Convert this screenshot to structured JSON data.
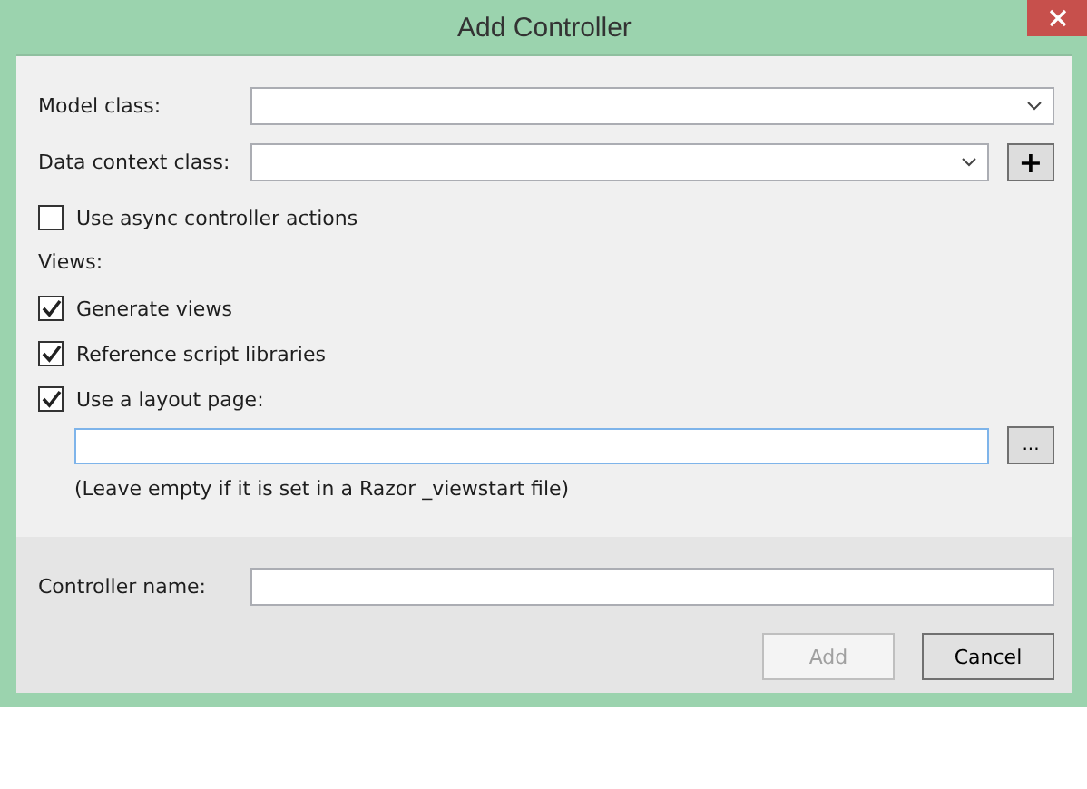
{
  "window": {
    "title": "Add Controller"
  },
  "form_rows": [
    {
      "label": "Model class:",
      "kind": "combo"
    },
    {
      "label": "Data context class:",
      "kind": "combo",
      "button": "+"
    }
  ],
  "async_option": {
    "label": "Use async controller actions",
    "checked": false
  },
  "views": {
    "label": "Views:",
    "options": [
      {
        "label": "Generate views",
        "checked": true
      },
      {
        "label": "Reference script libraries",
        "checked": true
      },
      {
        "label": "Use a layout page:",
        "checked": true
      }
    ],
    "layout_field": {
      "focused": true,
      "button": "..."
    },
    "hint": "(Leave empty if it is set in a Razor _viewstart file)"
  },
  "controller_name": {
    "label": "Controller name:"
  },
  "buttons": [
    {
      "label": "Add",
      "disabled": true
    },
    {
      "label": "Cancel",
      "disabled": false
    }
  ]
}
